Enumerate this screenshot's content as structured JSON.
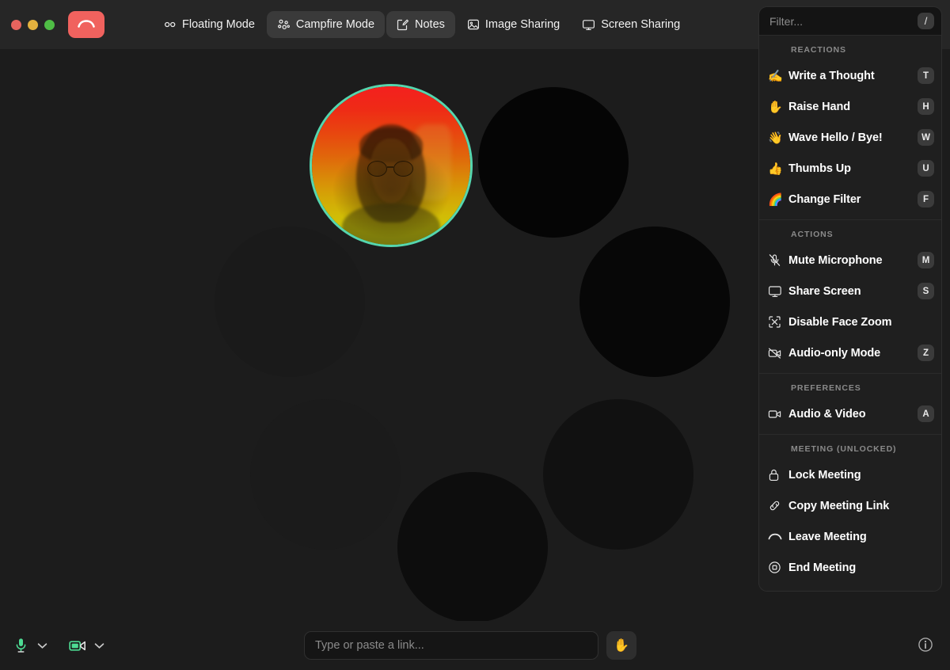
{
  "window": {
    "traffic_lights": [
      "close",
      "minimize",
      "maximize"
    ],
    "hangup_label": "Hang up"
  },
  "toolbar": {
    "items": [
      {
        "label": "Floating Mode",
        "icon": "floating-mode-icon",
        "active": false
      },
      {
        "label": "Campfire Mode",
        "icon": "campfire-mode-icon",
        "active": true
      },
      {
        "label": "Notes",
        "icon": "notes-icon",
        "active": true
      },
      {
        "label": "Image Sharing",
        "icon": "image-sharing-icon",
        "active": false
      },
      {
        "label": "Screen Sharing",
        "icon": "screen-sharing-icon",
        "active": false
      }
    ]
  },
  "stage": {
    "self_tile": {
      "ring_color": "#55d6ae",
      "filter": "red-yellow-gradient"
    },
    "participants": [
      {
        "state": "empty",
        "color": "#050505"
      },
      {
        "state": "empty",
        "color": "#1a1a1a"
      },
      {
        "state": "empty",
        "color": "#070707"
      },
      {
        "state": "empty",
        "color": "#1b1b1b"
      },
      {
        "state": "empty",
        "color": "#111111"
      },
      {
        "state": "empty",
        "color": "#0d0d0d"
      }
    ]
  },
  "panel": {
    "filter": {
      "placeholder": "Filter...",
      "value": "",
      "shortcut": "/"
    },
    "sections": [
      {
        "title": "REACTIONS",
        "items": [
          {
            "label": "Write a Thought",
            "icon": "✍️",
            "icon_name": "write-thought-icon",
            "shortcut": "T"
          },
          {
            "label": "Raise Hand",
            "icon": "✋",
            "icon_name": "raise-hand-icon",
            "shortcut": "H"
          },
          {
            "label": "Wave Hello / Bye!",
            "icon": "👋",
            "icon_name": "wave-icon",
            "shortcut": "W"
          },
          {
            "label": "Thumbs Up",
            "icon": "👍",
            "icon_name": "thumbs-up-icon",
            "shortcut": "U"
          },
          {
            "label": "Change Filter",
            "icon": "🌈",
            "icon_name": "rainbow-filter-icon",
            "shortcut": "F"
          }
        ]
      },
      {
        "title": "ACTIONS",
        "items": [
          {
            "label": "Mute Microphone",
            "icon": "",
            "icon_name": "mic-muted-icon",
            "shortcut": "M"
          },
          {
            "label": "Share Screen",
            "icon": "",
            "icon_name": "monitor-icon",
            "shortcut": "S"
          },
          {
            "label": "Disable Face Zoom",
            "icon": "",
            "icon_name": "face-zoom-icon",
            "shortcut": ""
          },
          {
            "label": "Audio-only Mode",
            "icon": "",
            "icon_name": "camera-off-icon",
            "shortcut": "Z"
          }
        ]
      },
      {
        "title": "PREFERENCES",
        "items": [
          {
            "label": "Audio & Video",
            "icon": "",
            "icon_name": "camera-icon",
            "shortcut": "A"
          }
        ]
      },
      {
        "title": "MEETING (UNLOCKED)",
        "items": [
          {
            "label": "Lock Meeting",
            "icon": "",
            "icon_name": "lock-icon",
            "shortcut": ""
          },
          {
            "label": "Copy Meeting Link",
            "icon": "",
            "icon_name": "link-icon",
            "shortcut": ""
          },
          {
            "label": "Leave Meeting",
            "icon": "",
            "icon_name": "phone-down-icon",
            "shortcut": ""
          },
          {
            "label": "End Meeting",
            "icon": "",
            "icon_name": "end-meeting-icon",
            "shortcut": ""
          }
        ]
      }
    ]
  },
  "bottom": {
    "mic": {
      "icon_name": "microphone-icon",
      "state": "on",
      "color": "#4ddb93"
    },
    "camera": {
      "icon_name": "camera-icon",
      "state": "on",
      "color": "#4ddb93"
    },
    "link_input": {
      "placeholder": "Type or paste a link...",
      "value": ""
    },
    "hand_button": {
      "icon": "✋",
      "icon_name": "raise-hand-icon"
    },
    "info_button": {
      "icon_name": "info-icon"
    }
  }
}
